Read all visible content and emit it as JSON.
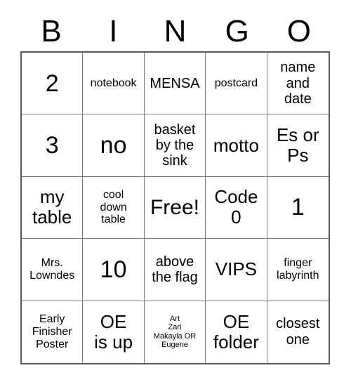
{
  "card": {
    "title": "BINGO",
    "header_letters": [
      "B",
      "I",
      "N",
      "G",
      "O"
    ],
    "free_space_label": "Free!",
    "colors": {
      "background": "#ffffff",
      "text": "#000000",
      "outer_border": "#5a5a5a",
      "inner_border": "#7a7a7a"
    },
    "rows": [
      [
        {
          "text": "2",
          "size": "fs-xxl"
        },
        {
          "text": "notebook",
          "size": "fs-sm"
        },
        {
          "text": "MENSA",
          "size": "fs-md"
        },
        {
          "text": "postcard",
          "size": "fs-sm"
        },
        {
          "text": "name\nand\ndate",
          "size": "fs-md"
        }
      ],
      [
        {
          "text": "3",
          "size": "fs-xxl"
        },
        {
          "text": "no",
          "size": "fs-xxl"
        },
        {
          "text": "basket\nby the\nsink",
          "size": "fs-md"
        },
        {
          "text": "motto",
          "size": "fs-lg"
        },
        {
          "text": "Es or\nPs",
          "size": "fs-lg"
        }
      ],
      [
        {
          "text": "my\ntable",
          "size": "fs-lg"
        },
        {
          "text": "cool\ndown\ntable",
          "size": "fs-sm"
        },
        {
          "text": "Free!",
          "size": "fs-xl"
        },
        {
          "text": "Code\n0",
          "size": "fs-lg"
        },
        {
          "text": "1",
          "size": "fs-xxl"
        }
      ],
      [
        {
          "text": "Mrs.\nLowndes",
          "size": "fs-sm"
        },
        {
          "text": "10",
          "size": "fs-xxl"
        },
        {
          "text": "above\nthe flag",
          "size": "fs-md"
        },
        {
          "text": "VIPS",
          "size": "fs-lg"
        },
        {
          "text": "finger\nlabyrinth",
          "size": "fs-sm"
        }
      ],
      [
        {
          "text": "Early\nFinisher\nPoster",
          "size": "fs-sm"
        },
        {
          "text": "OE\nis up",
          "size": "fs-lg"
        },
        {
          "text": "Art\nZari\nMakayla OR\nEugene",
          "size": "fs-xs"
        },
        {
          "text": "OE\nfolder",
          "size": "fs-lg"
        },
        {
          "text": "closest\none",
          "size": "fs-md"
        }
      ]
    ]
  }
}
